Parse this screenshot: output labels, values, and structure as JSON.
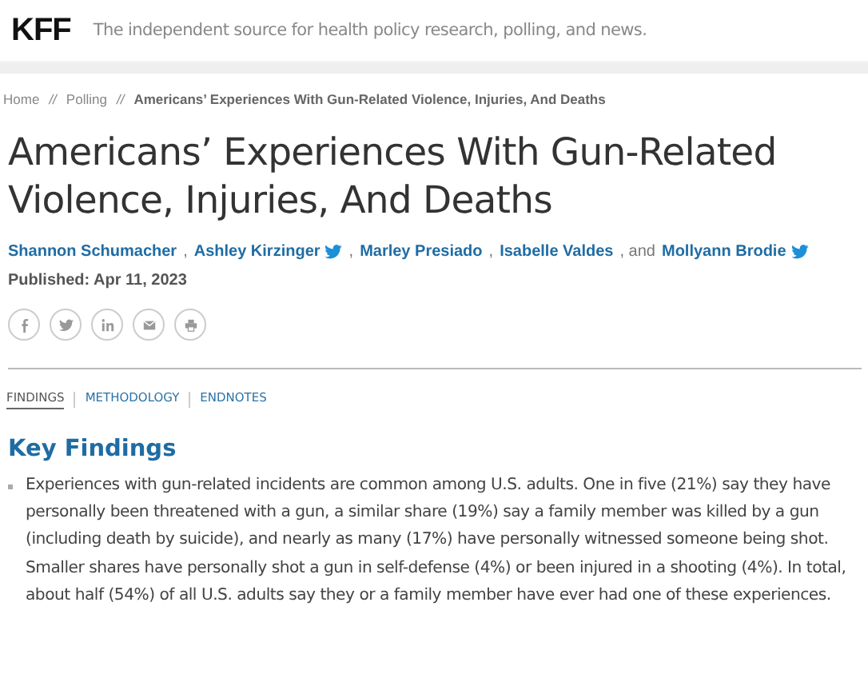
{
  "header": {
    "logo": "KFF",
    "tagline": "The independent source for health policy research, polling, and news."
  },
  "breadcrumb": [
    {
      "label": "Home",
      "current": false
    },
    {
      "label": "Polling",
      "current": false
    },
    {
      "label": "Americans’ Experiences With Gun-Related Violence, Injuries, And Deaths",
      "current": true
    }
  ],
  "breadcrumb_separator": "//",
  "title": "Americans’ Experiences With Gun-Related Violence, Injuries, And Deaths",
  "authors": [
    {
      "name": "Shannon Schumacher",
      "twitter": false
    },
    {
      "separator": ",",
      "name": "Ashley Kirzinger",
      "twitter": true
    },
    {
      "separator": ",",
      "name": "Marley Presiado",
      "twitter": false
    },
    {
      "separator": ",",
      "name": "Isabelle Valdes",
      "twitter": false
    },
    {
      "separator": ", and",
      "name": "Mollyann Brodie",
      "twitter": true
    }
  ],
  "published": "Published: Apr 11, 2023",
  "share": [
    {
      "kind": "facebook"
    },
    {
      "kind": "twitter"
    },
    {
      "kind": "linkedin"
    },
    {
      "kind": "email"
    },
    {
      "kind": "print"
    }
  ],
  "tabs": [
    {
      "label": "FINDINGS",
      "selected": true
    },
    {
      "label": "METHODOLOGY",
      "selected": false
    },
    {
      "label": "ENDNOTES",
      "selected": false
    }
  ],
  "section_heading": "Key Findings",
  "bullets": [
    "Experiences with gun-related incidents are common among U.S. adults. One in five (21%) say they have personally been threatened with a gun, a similar share (19%) say a family member was killed by a gun (including death by suicide), and nearly as many (17%) have personally witnessed someone being shot. Smaller shares have personally shot a gun in self-defense (4%) or been injured in a shooting (4%). In total, about half (54%) of all U.S. adults say they or a family member have ever had one of these experiences."
  ]
}
